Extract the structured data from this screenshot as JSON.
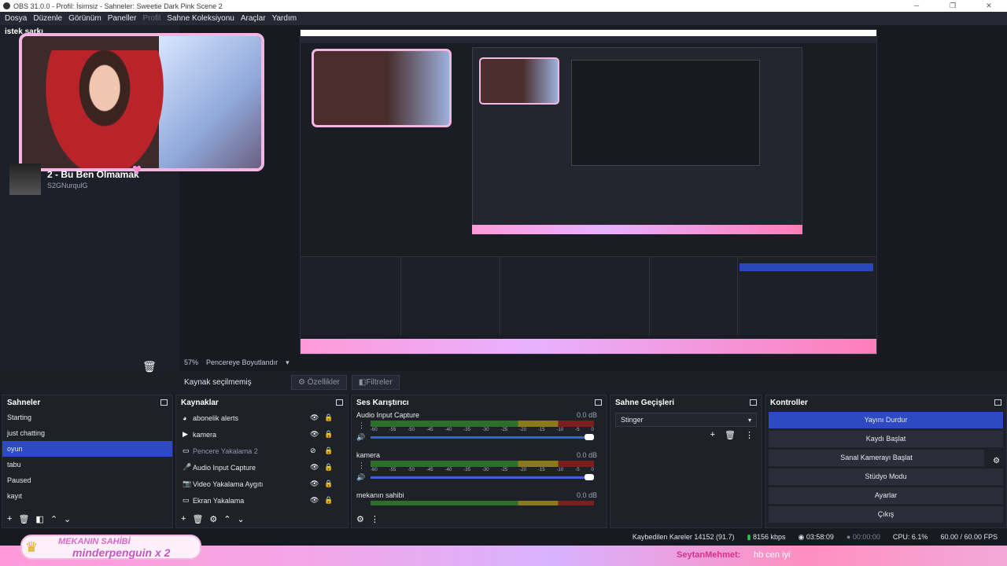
{
  "window": {
    "title": "OBS 31.0.0 - Profil: İsimsiz - Sahneler: Sweetie Dark Pink Scene 2",
    "controls": [
      "─",
      "❐",
      "✕"
    ]
  },
  "menu": [
    "Dosya",
    "Düzenle",
    "Görünüm",
    "Paneller",
    "Profil",
    "Sahne Koleksiyonu",
    "Araçlar",
    "Yardım"
  ],
  "left_dock": {
    "title": "istek şarkı",
    "song_title": "2 - Bu Ben Olmamak",
    "song_artist": "S2GNurqulG"
  },
  "preview": {
    "zoom": "57%",
    "fit_label": "Pencereye Boyutlandır",
    "no_source": "Kaynak seçilmemiş",
    "properties_label": "Özellikler",
    "filters_label": "Filtreler"
  },
  "scenes": {
    "title": "Sahneler",
    "items": [
      "Starting",
      "just chatting",
      "oyun",
      "tabu",
      "Paused",
      "kayıt"
    ],
    "selected": "oyun"
  },
  "sources": {
    "title": "Kaynaklar",
    "items": [
      {
        "label": "abonelik alerts",
        "icon": "alert-icon",
        "visible": true
      },
      {
        "label": "kamera",
        "icon": "play-icon",
        "visible": true
      },
      {
        "label": "Pencere Yakalama 2",
        "icon": "window-icon",
        "visible": false
      },
      {
        "label": "Audio Input Capture",
        "icon": "mic-icon",
        "visible": true
      },
      {
        "label": "Video Yakalama Aygıtı",
        "icon": "camera-icon",
        "visible": true
      },
      {
        "label": "Ekran Yakalama",
        "icon": "monitor-icon",
        "visible": true
      }
    ]
  },
  "mixer": {
    "title": "Ses Karıştırıcı",
    "ticks": [
      "-60",
      "-55",
      "-50",
      "-45",
      "-40",
      "-35",
      "-30",
      "-25",
      "-20",
      "-15",
      "-10",
      "-5",
      "0"
    ],
    "channels": [
      {
        "name": "Audio Input Capture",
        "db": "0.0 dB"
      },
      {
        "name": "kamera",
        "db": "0.0 dB"
      },
      {
        "name": "mekanın sahibi",
        "db": "0.0 dB"
      }
    ]
  },
  "transitions": {
    "title": "Sahne Geçişleri",
    "selected": "Stinger"
  },
  "controls": {
    "title": "Kontroller",
    "buttons": [
      "Yayını Durdur",
      "Kaydı Başlat",
      "Sanal Kamerayı Başlat",
      "Stüdyo Modu",
      "Ayarlar",
      "Çıkış"
    ]
  },
  "status": {
    "dropped_frames": "Kaybedilen Kareler 14152 (91.7)",
    "bitrate": "8156 kbps",
    "stream_time": "03:58:09",
    "record_time": "00:00:00",
    "cpu": "CPU: 6.1%",
    "fps": "60.00 / 60.00 FPS"
  },
  "overlay": {
    "badge_line1": "MEKANIN SAHİBİ",
    "badge_line2": "minderpenguin x 2",
    "chat_name": "SeytanMehmet:",
    "chat_msg": "hb cen iyi"
  },
  "colors": {
    "accent": "#2d4ac2",
    "pink": "#f3b6e3"
  }
}
